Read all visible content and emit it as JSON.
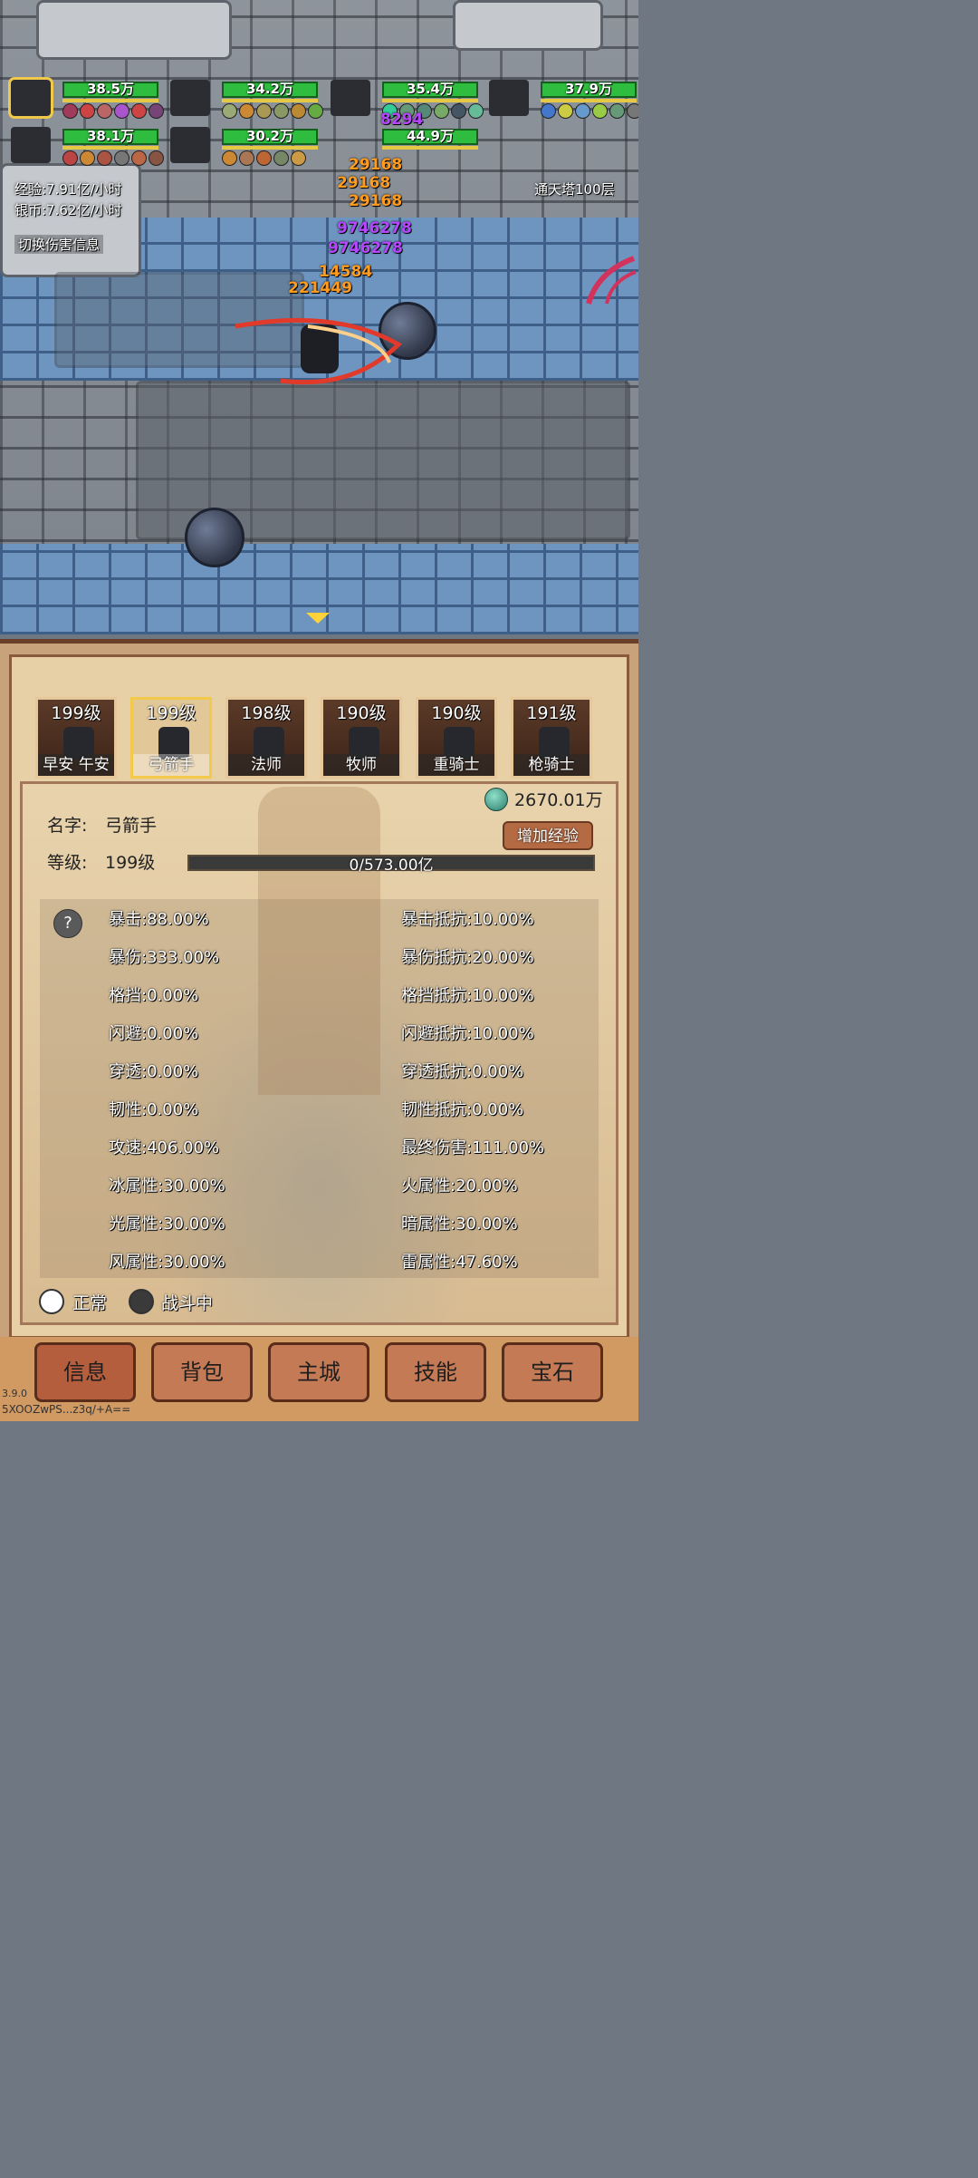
{
  "party": [
    {
      "hp": "38.5万",
      "selected": true
    },
    {
      "hp": "34.2万"
    },
    {
      "hp": "35.4万"
    },
    {
      "hp": "37.9万"
    },
    {
      "hp": "38.1万"
    },
    {
      "hp": "30.2万"
    },
    {
      "hp": "44.9万"
    }
  ],
  "stats": {
    "exp_rate": "经验:7.91亿/小时",
    "silver_rate": "银币:7.62亿/小时",
    "toggle_damage": "切换伤害信息",
    "stage": "通天塔100层"
  },
  "damage_numbers": [
    "29168",
    "29168",
    "29168",
    "9746278",
    "9746278",
    "14584",
    "221449",
    "8294"
  ],
  "characters": [
    {
      "level": "199级",
      "name": "早安 午安"
    },
    {
      "level": "199级",
      "name": "弓箭手",
      "selected": true
    },
    {
      "level": "198级",
      "name": "法师"
    },
    {
      "level": "190级",
      "name": "牧师"
    },
    {
      "level": "190级",
      "name": "重骑士"
    },
    {
      "level": "191级",
      "name": "枪骑士"
    }
  ],
  "detail": {
    "currency": "2670.01万",
    "add_exp": "增加经验",
    "name_label": "名字:",
    "name_value": "弓箭手",
    "level_label": "等级:",
    "level_value": "199级",
    "exp_progress": "0/573.00亿",
    "help": "?"
  },
  "attributes_left": [
    "暴击:88.00%",
    "暴伤:333.00%",
    "格挡:0.00%",
    "闪避:0.00%",
    "穿透:0.00%",
    "韧性:0.00%",
    "攻速:406.00%",
    "冰属性:30.00%",
    "光属性:30.00%",
    "风属性:30.00%"
  ],
  "attributes_right": [
    "暴击抵抗:10.00%",
    "暴伤抵抗:20.00%",
    "格挡抵抗:10.00%",
    "闪避抵抗:10.00%",
    "穿透抵抗:0.00%",
    "韧性抵抗:0.00%",
    "最终伤害:111.00%",
    "火属性:20.00%",
    "暗属性:30.00%",
    "雷属性:47.60%"
  ],
  "status": {
    "normal": "正常",
    "in_battle": "战斗中"
  },
  "tabs": [
    "信息",
    "背包",
    "主城",
    "技能",
    "宝石"
  ],
  "footer": {
    "version": "3.9.0",
    "user_id": "5XOOZwPS...z3q/+A=="
  }
}
